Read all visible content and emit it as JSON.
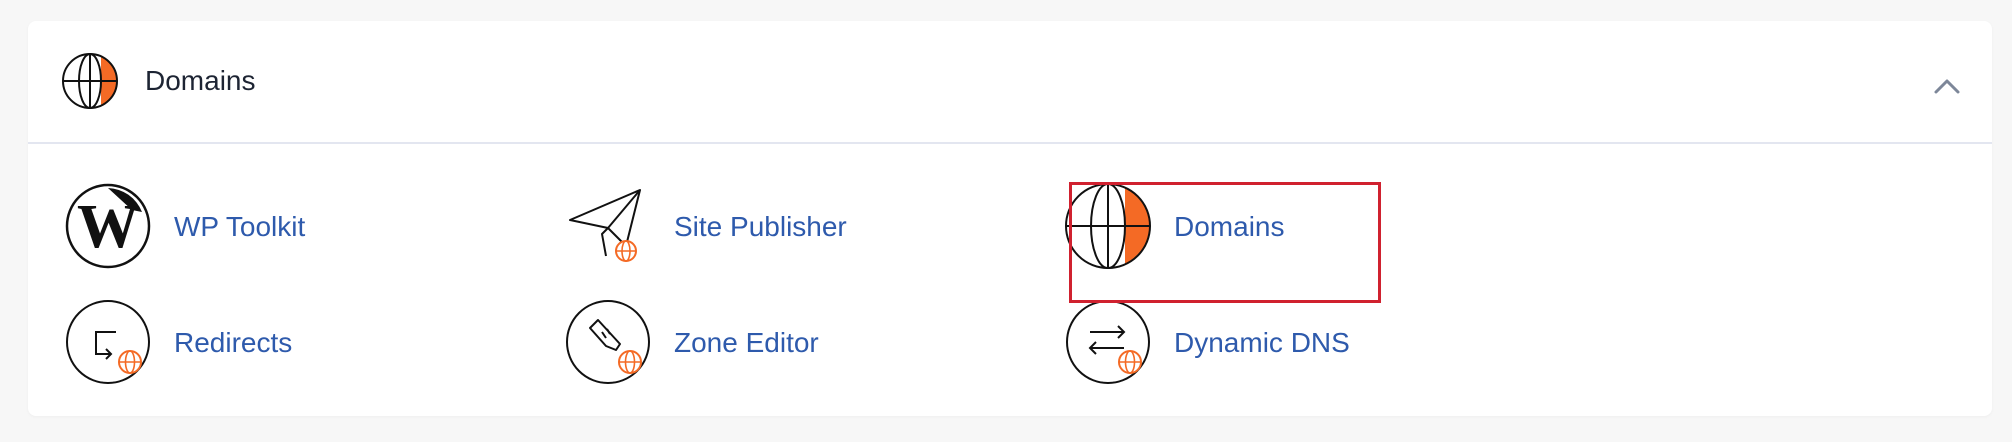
{
  "section": {
    "title": "Domains",
    "header_icon": "globe-icon",
    "collapse_icon": "chevron-up-icon"
  },
  "items": [
    {
      "label": "WP Toolkit",
      "icon": "wordpress-icon"
    },
    {
      "label": "Site Publisher",
      "icon": "paper-plane-globe-icon"
    },
    {
      "label": "Domains",
      "icon": "globe-icon"
    },
    {
      "label": "Redirects",
      "icon": "redirect-arrow-globe-icon"
    },
    {
      "label": "Zone Editor",
      "icon": "pen-globe-icon"
    },
    {
      "label": "Dynamic DNS",
      "icon": "swap-arrows-globe-icon"
    }
  ],
  "highlighted_item": "Domains",
  "colors": {
    "accent_orange": "#f46a25",
    "link_blue": "#2e5aac",
    "highlight_red": "#d0212f"
  }
}
